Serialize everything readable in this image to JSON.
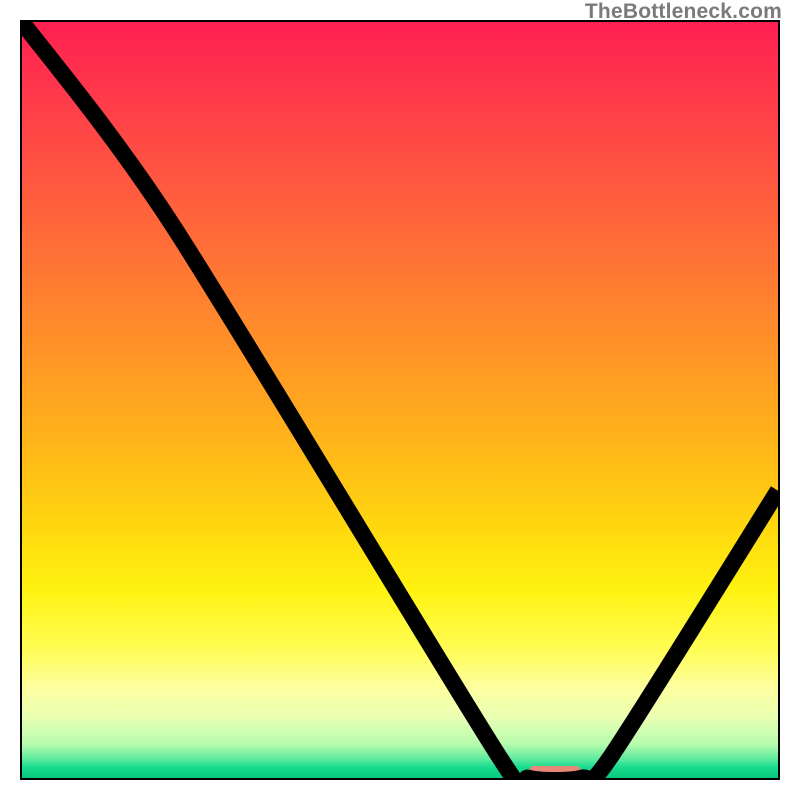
{
  "watermark": "TheBottleneck.com",
  "chart_data": {
    "type": "line",
    "title": "",
    "xlabel": "",
    "ylabel": "",
    "xlim": [
      0,
      100
    ],
    "ylim": [
      0,
      100
    ],
    "grid": false,
    "curve_points": [
      {
        "x": 0,
        "y": 100
      },
      {
        "x": 20,
        "y": 73
      },
      {
        "x": 63,
        "y": 3
      },
      {
        "x": 67,
        "y": 0
      },
      {
        "x": 74,
        "y": 0
      },
      {
        "x": 78,
        "y": 3
      },
      {
        "x": 100,
        "y": 38
      }
    ],
    "marker": {
      "x_start": 67,
      "x_end": 74,
      "y": 0,
      "color": "#e88878"
    },
    "background_gradient_stops": [
      {
        "pct": 0,
        "color": "#ff1f52"
      },
      {
        "pct": 10,
        "color": "#ff3a4a"
      },
      {
        "pct": 22,
        "color": "#ff5a3f"
      },
      {
        "pct": 34,
        "color": "#ff7a32"
      },
      {
        "pct": 46,
        "color": "#ff9a24"
      },
      {
        "pct": 57,
        "color": "#ffb918"
      },
      {
        "pct": 67,
        "color": "#ffd80f"
      },
      {
        "pct": 75,
        "color": "#fff20f"
      },
      {
        "pct": 83,
        "color": "#fffd55"
      },
      {
        "pct": 88,
        "color": "#fdff9f"
      },
      {
        "pct": 92,
        "color": "#e9ffb3"
      },
      {
        "pct": 95.5,
        "color": "#b7fcad"
      },
      {
        "pct": 97.5,
        "color": "#5feaa0"
      },
      {
        "pct": 98.5,
        "color": "#1bdd8f"
      },
      {
        "pct": 100,
        "color": "#06c97e"
      }
    ]
  }
}
